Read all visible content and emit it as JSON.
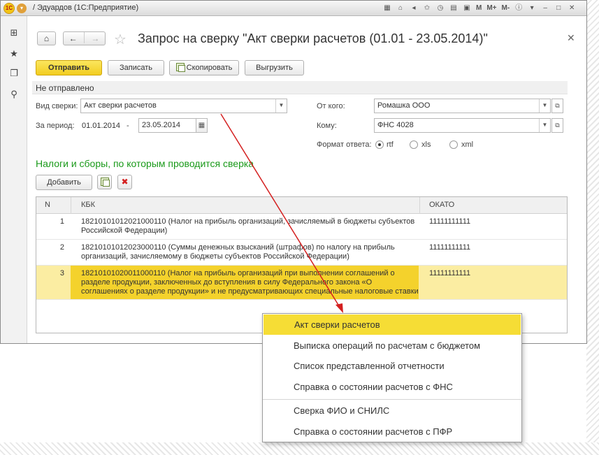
{
  "window": {
    "title": "/ Эдуардов (1С:Предприятие)",
    "toolbar_text_buttons": [
      "M",
      "M+",
      "M-"
    ]
  },
  "form": {
    "title": "Запрос на сверку \"Акт сверки расчетов (01.01 - 23.05.2014)\"",
    "buttons": {
      "send": "Отправить",
      "save": "Записать",
      "copy": "Скопировать",
      "export": "Выгрузить"
    },
    "status": "Не отправлено",
    "fields": {
      "type_label": "Вид сверки:",
      "type_value": "Акт сверки расчетов",
      "period_label": "За период:",
      "period_from": "01.01.2014",
      "period_dash": "-",
      "period_to": "23.05.2014",
      "from_label": "От кого:",
      "from_value": "Ромашка ООО",
      "to_label": "Кому:",
      "to_value": "ФНС 4028",
      "format_label": "Формат ответа:",
      "formats": [
        "rtf",
        "xls",
        "xml"
      ],
      "format_selected": "rtf"
    }
  },
  "section": {
    "title": "Налоги и сборы, по которым проводится сверка",
    "add_button": "Добавить"
  },
  "table": {
    "columns": [
      "N",
      "КБК",
      "ОКАТО"
    ],
    "rows": [
      {
        "n": "1",
        "kbk": "18210101012021000110 (Налог на прибыль организаций, зачисляемый в бюджеты субъектов Российской Федерации)",
        "okato": "11111111111"
      },
      {
        "n": "2",
        "kbk": "18210101012023000110 (Суммы денежных взысканий (штрафов) по налогу на прибыль организаций, зачисляемому в бюджеты субъектов Российской Федерации)",
        "okato": "11111111111"
      },
      {
        "n": "3",
        "kbk": "18210101020011000110 (Налог на прибыль организаций при выполнении соглашений о разделе продукции, заключенных до вступления в силу Федерального закона «О соглашениях о разделе продукции» и не предусматривающих специальные налоговые ставки",
        "okato": "11111111111"
      }
    ]
  },
  "dropdown": {
    "items": [
      "Акт сверки расчетов",
      "Выписка операций по расчетам с бюджетом",
      "Список представленной отчетности",
      "Справка о состоянии расчетов с ФНС",
      "Сверка ФИО и СНИЛС",
      "Справка о состоянии расчетов с ПФР"
    ],
    "active_index": 0
  },
  "colors": {
    "accent_yellow": "#f2cd20",
    "selected_row": "#fbeda2",
    "section_green": "#1a9a1a",
    "arrow_red": "#d42020"
  }
}
